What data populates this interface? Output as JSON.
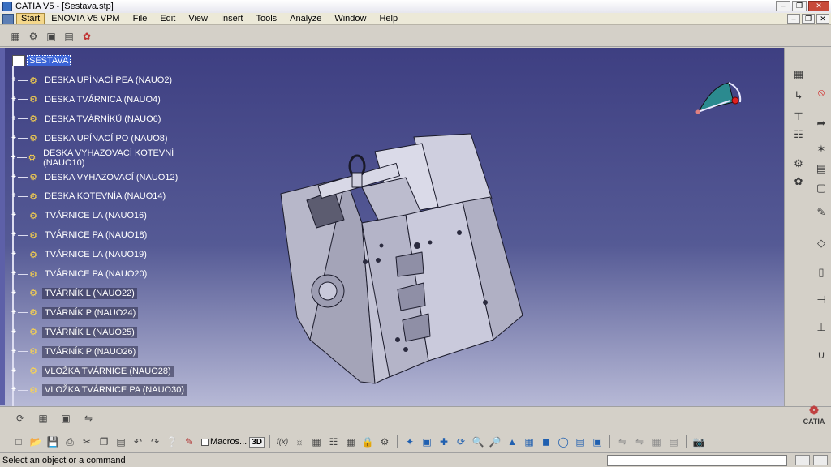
{
  "window": {
    "title": "CATIA V5 - [Sestava.stp]"
  },
  "menubar": {
    "items": [
      "Start",
      "ENOVIA V5 VPM",
      "File",
      "Edit",
      "View",
      "Insert",
      "Tools",
      "Analyze",
      "Window",
      "Help"
    ]
  },
  "tree": {
    "root": "SESTAVA",
    "items": [
      "DESKA UPÍNACÍ PEA (NAUO2)",
      "DESKA TVÁRNICA (NAUO4)",
      "DESKA TVÁRNÍKŮ (NAUO6)",
      "DESKA UPÍNACÍ PO (NAUO8)",
      "DESKA VYHAZOVACÍ KOTEVNÍ (NAUO10)",
      "DESKA VYHAZOVACÍ (NAUO12)",
      "DESKA KOTEVNÍA (NAUO14)",
      "TVÁRNICE LA (NAUO16)",
      "TVÁRNICE PA (NAUO18)",
      "TVÁRNICE LA (NAUO19)",
      "TVÁRNICE PA (NAUO20)",
      "TVÁRNÍK L (NAUO22)",
      "TVÁRNÍK P (NAUO24)",
      "TVÁRNÍK L (NAUO25)",
      "TVÁRNÍK P (NAUO26)",
      "VLOŽKA TVÁRNICE (NAUO28)",
      "VLOŽKA TVÁRNICE PA (NAUO30)"
    ]
  },
  "toolbar": {
    "macros_label": "Macros...",
    "btn_3d": "3D",
    "fx_label": "f(x)"
  },
  "status": {
    "text": "Select an object or a command"
  },
  "logo": {
    "text": "CATIA"
  }
}
